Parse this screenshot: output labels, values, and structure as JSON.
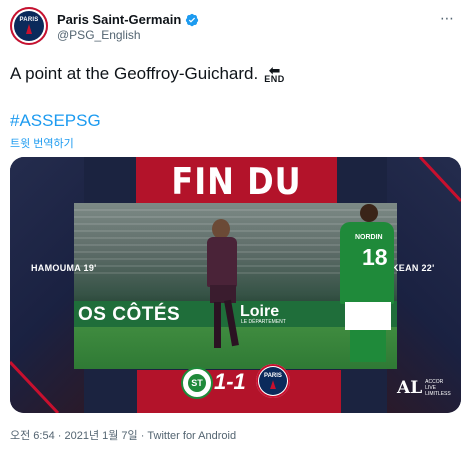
{
  "author": {
    "display_name": "Paris Saint-Germain",
    "handle": "@PSG_English",
    "avatar_icon": "psg-crest",
    "avatar_text": "PARIS",
    "avatar_subtext": "SAINT-GERMAIN"
  },
  "tweet": {
    "text": "A point at the Geoffroy-Guichard.",
    "emoji_arrow": "⬅",
    "emoji_word": "END",
    "hashtag": "#ASSEPSG",
    "translate_label": "트윗 번역하기"
  },
  "media": {
    "headline": "FIN DU MATCH",
    "scorer_left": "HAMOUMA 19'",
    "scorer_right": "KEAN 22'",
    "score": "1-1",
    "home_crest_text": "ST",
    "away_crest_text": "PARIS",
    "away_crest_subtext": "SAINT-GERMAIN",
    "ad_board_text": "OS CÔTÉS",
    "ad_board_text2": "Loire",
    "ad_board_small": "LE DÉPARTEMENT",
    "player_name": "NORDIN",
    "player_number": "18",
    "sponsor_big": "AL",
    "sponsor_small": "ACCOR\nLIVE\nLIMITLESS"
  },
  "meta": {
    "timestamp": "오전 6:54 · 2021년 1월 7일 · Twitter for Android"
  },
  "colors": {
    "link": "#1d9bf0",
    "psg_navy": "#0b2a5b",
    "psg_red": "#c8102e",
    "asse_green": "#1f8a3a"
  }
}
